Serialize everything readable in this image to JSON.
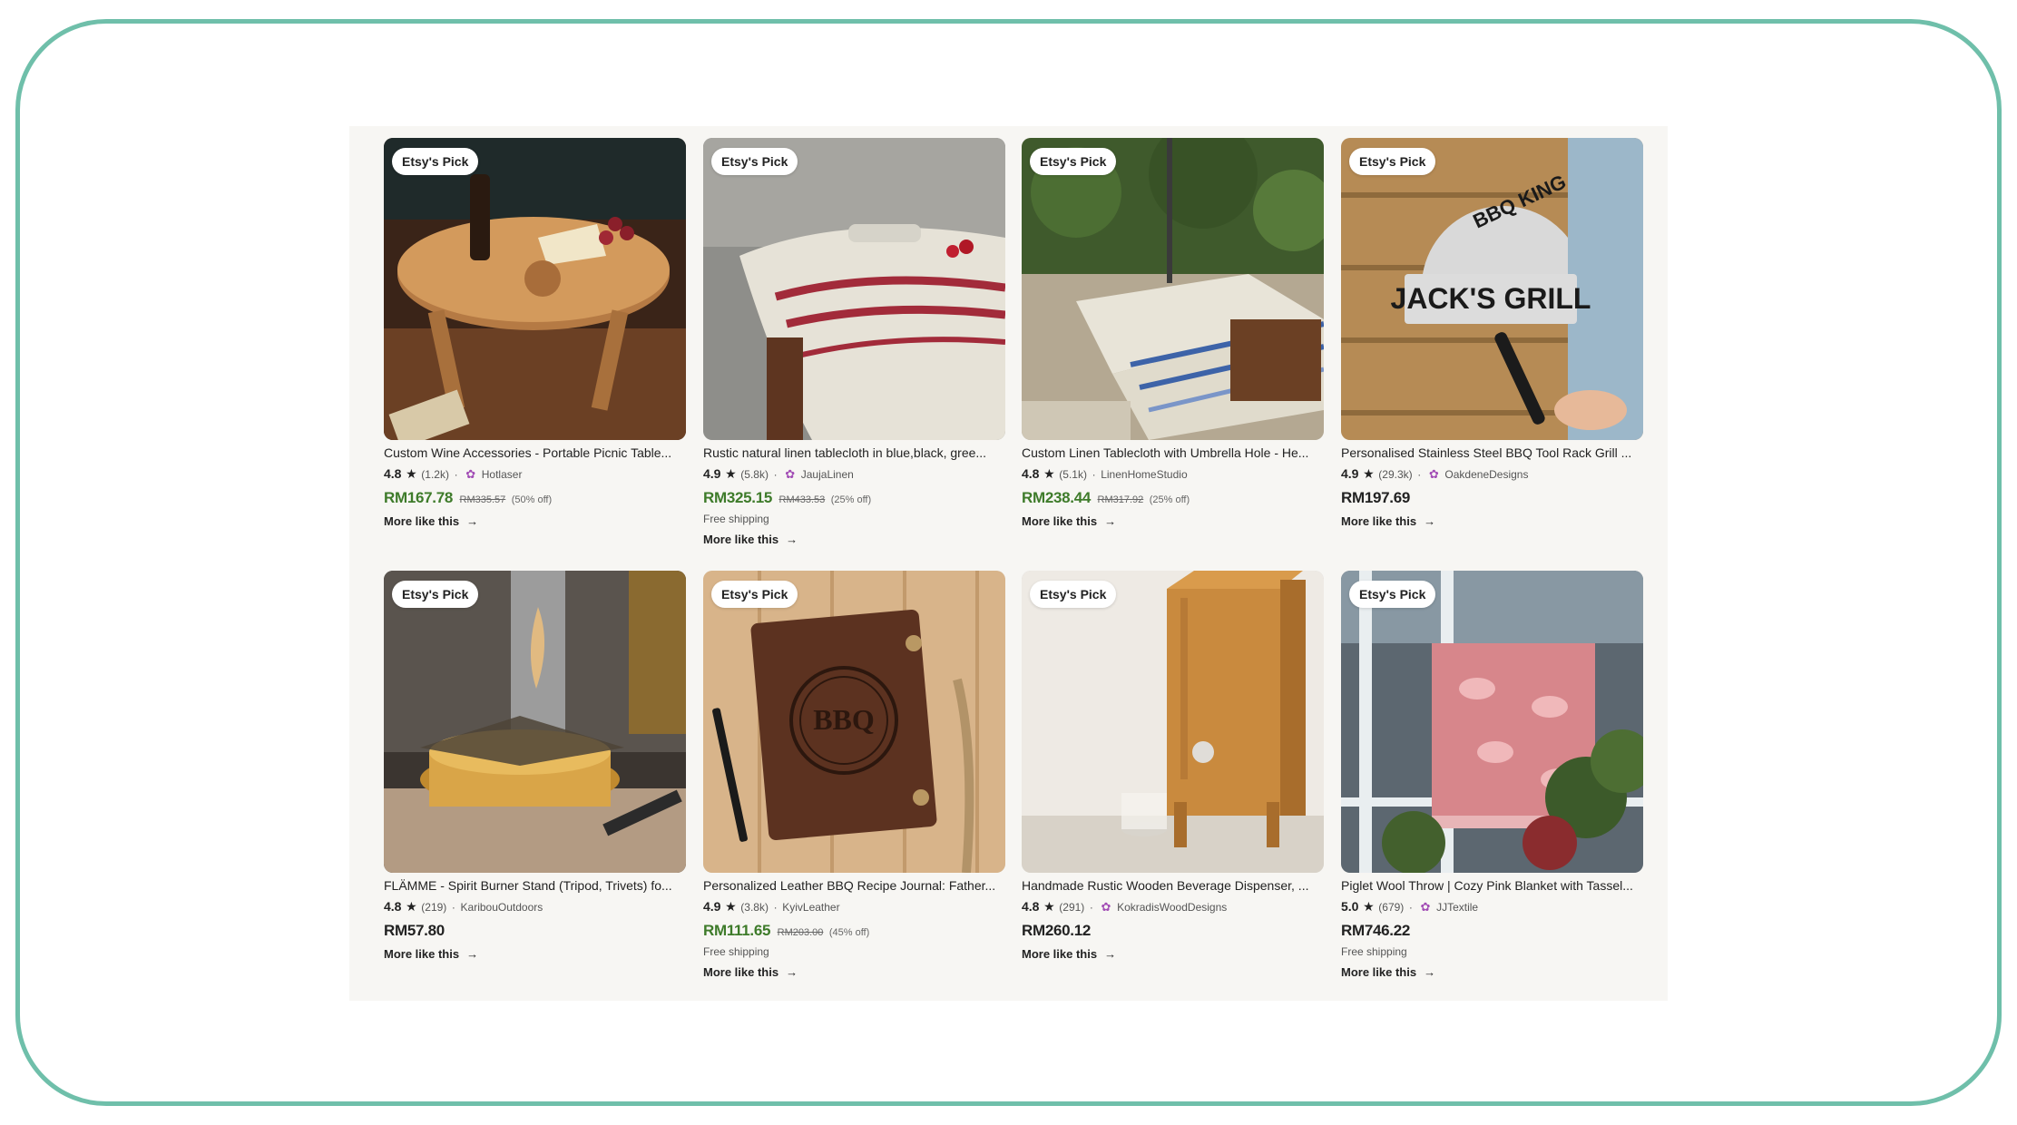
{
  "badge_label": "Etsy's Pick",
  "more_label": "More like this",
  "colors": {
    "sale_price": "#3e7b2a",
    "shop_icon": "#a24db5",
    "frame": "#6fbfaa"
  },
  "products": [
    {
      "title": "Custom Wine Accessories - Portable Picnic Table...",
      "rating": "4.8",
      "reviews": "(1.2k)",
      "shop": "Hotlaser",
      "price": "RM167.78",
      "original_price": "RM335.57",
      "discount": "(50% off)",
      "shipping": ""
    },
    {
      "title": "Rustic natural linen tablecloth in blue,black, gree...",
      "rating": "4.9",
      "reviews": "(5.8k)",
      "shop": "JaujaLinen",
      "price": "RM325.15",
      "original_price": "RM433.53",
      "discount": "(25% off)",
      "shipping": "Free shipping"
    },
    {
      "title": "Custom Linen Tablecloth with Umbrella Hole - He...",
      "rating": "4.8",
      "reviews": "(5.1k)",
      "shop": "LinenHomeStudio",
      "price": "RM238.44",
      "original_price": "RM317.92",
      "discount": "(25% off)",
      "shipping": ""
    },
    {
      "title": "Personalised Stainless Steel BBQ Tool Rack Grill ...",
      "rating": "4.9",
      "reviews": "(29.3k)",
      "shop": "OakdeneDesigns",
      "price": "RM197.69",
      "original_price": "",
      "discount": "",
      "shipping": ""
    },
    {
      "title": "FLÄMME - Spirit Burner Stand (Tripod, Trivets) fo...",
      "rating": "4.8",
      "reviews": "(219)",
      "shop": "KaribouOutdoors",
      "price": "RM57.80",
      "original_price": "",
      "discount": "",
      "shipping": ""
    },
    {
      "title": "Personalized Leather BBQ Recipe Journal: Father...",
      "rating": "4.9",
      "reviews": "(3.8k)",
      "shop": "KyivLeather",
      "price": "RM111.65",
      "original_price": "RM203.00",
      "discount": "(45% off)",
      "shipping": "Free shipping"
    },
    {
      "title": "Handmade Rustic Wooden Beverage Dispenser, ...",
      "rating": "4.8",
      "reviews": "(291)",
      "shop": "KokradisWoodDesigns",
      "price": "RM260.12",
      "original_price": "",
      "discount": "",
      "shipping": ""
    },
    {
      "title": "Piglet Wool Throw | Cozy Pink Blanket with Tassel...",
      "rating": "5.0",
      "reviews": "(679)",
      "shop": "JJTextile",
      "price": "RM746.22",
      "original_price": "",
      "discount": "",
      "shipping": "Free shipping"
    }
  ]
}
